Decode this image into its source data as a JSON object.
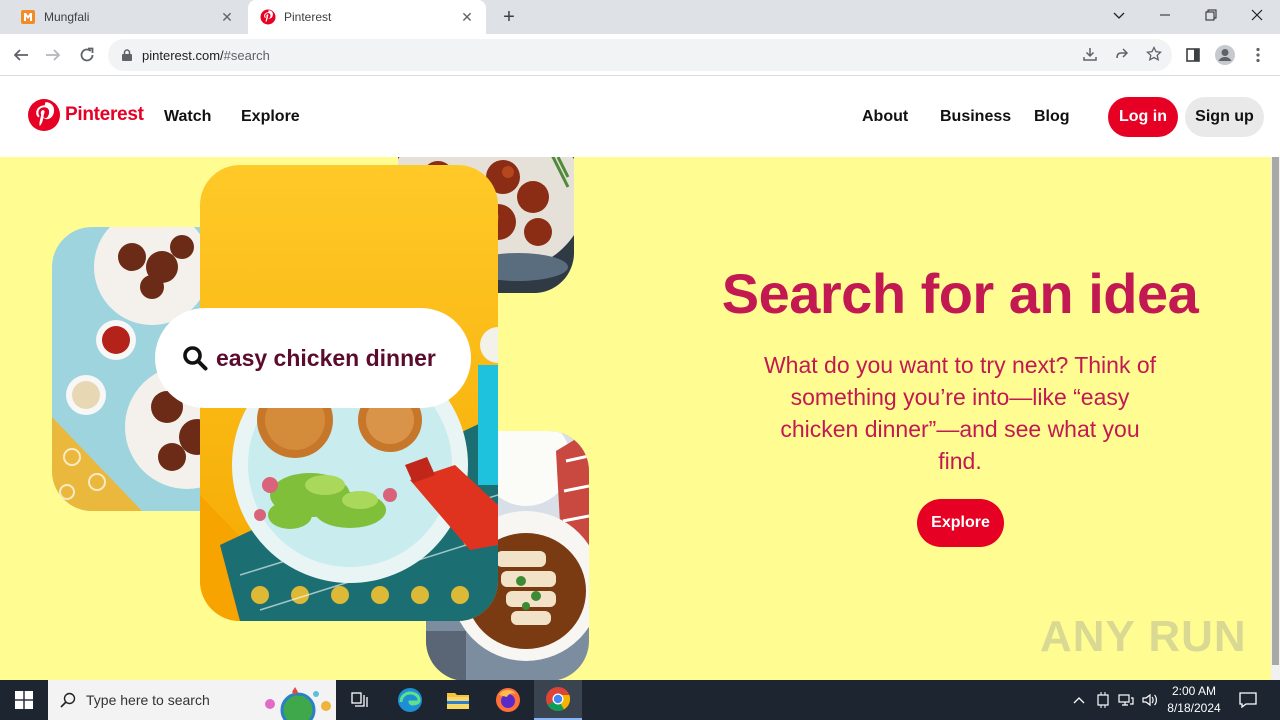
{
  "browser": {
    "tabs": [
      {
        "title": "Mungfali",
        "icon": "mungfali-favicon"
      },
      {
        "title": "Pinterest",
        "icon": "pinterest-favicon"
      }
    ],
    "url_host": "pinterest.com/",
    "url_path": "#search"
  },
  "header": {
    "brand": "Pinterest",
    "nav_left": [
      "Watch",
      "Explore"
    ],
    "nav_right": [
      "About",
      "Business",
      "Blog"
    ],
    "login_label": "Log in",
    "signup_label": "Sign up"
  },
  "hero": {
    "headline": "Search for an idea",
    "subtext": "What do you want to try next? Think of something you’re into—like “easy chicken dinner”—and see what you find.",
    "search_example": "easy chicken dinner",
    "explore_label": "Explore"
  },
  "watermark": "ANY RUN",
  "taskbar": {
    "search_placeholder": "Type here to search",
    "time": "2:00 AM",
    "date": "8/18/2024"
  },
  "colors": {
    "pinterest_red": "#e60023",
    "headline": "#c31952",
    "hero_bg": "#fffd92",
    "search_text": "#5b0c2c"
  }
}
